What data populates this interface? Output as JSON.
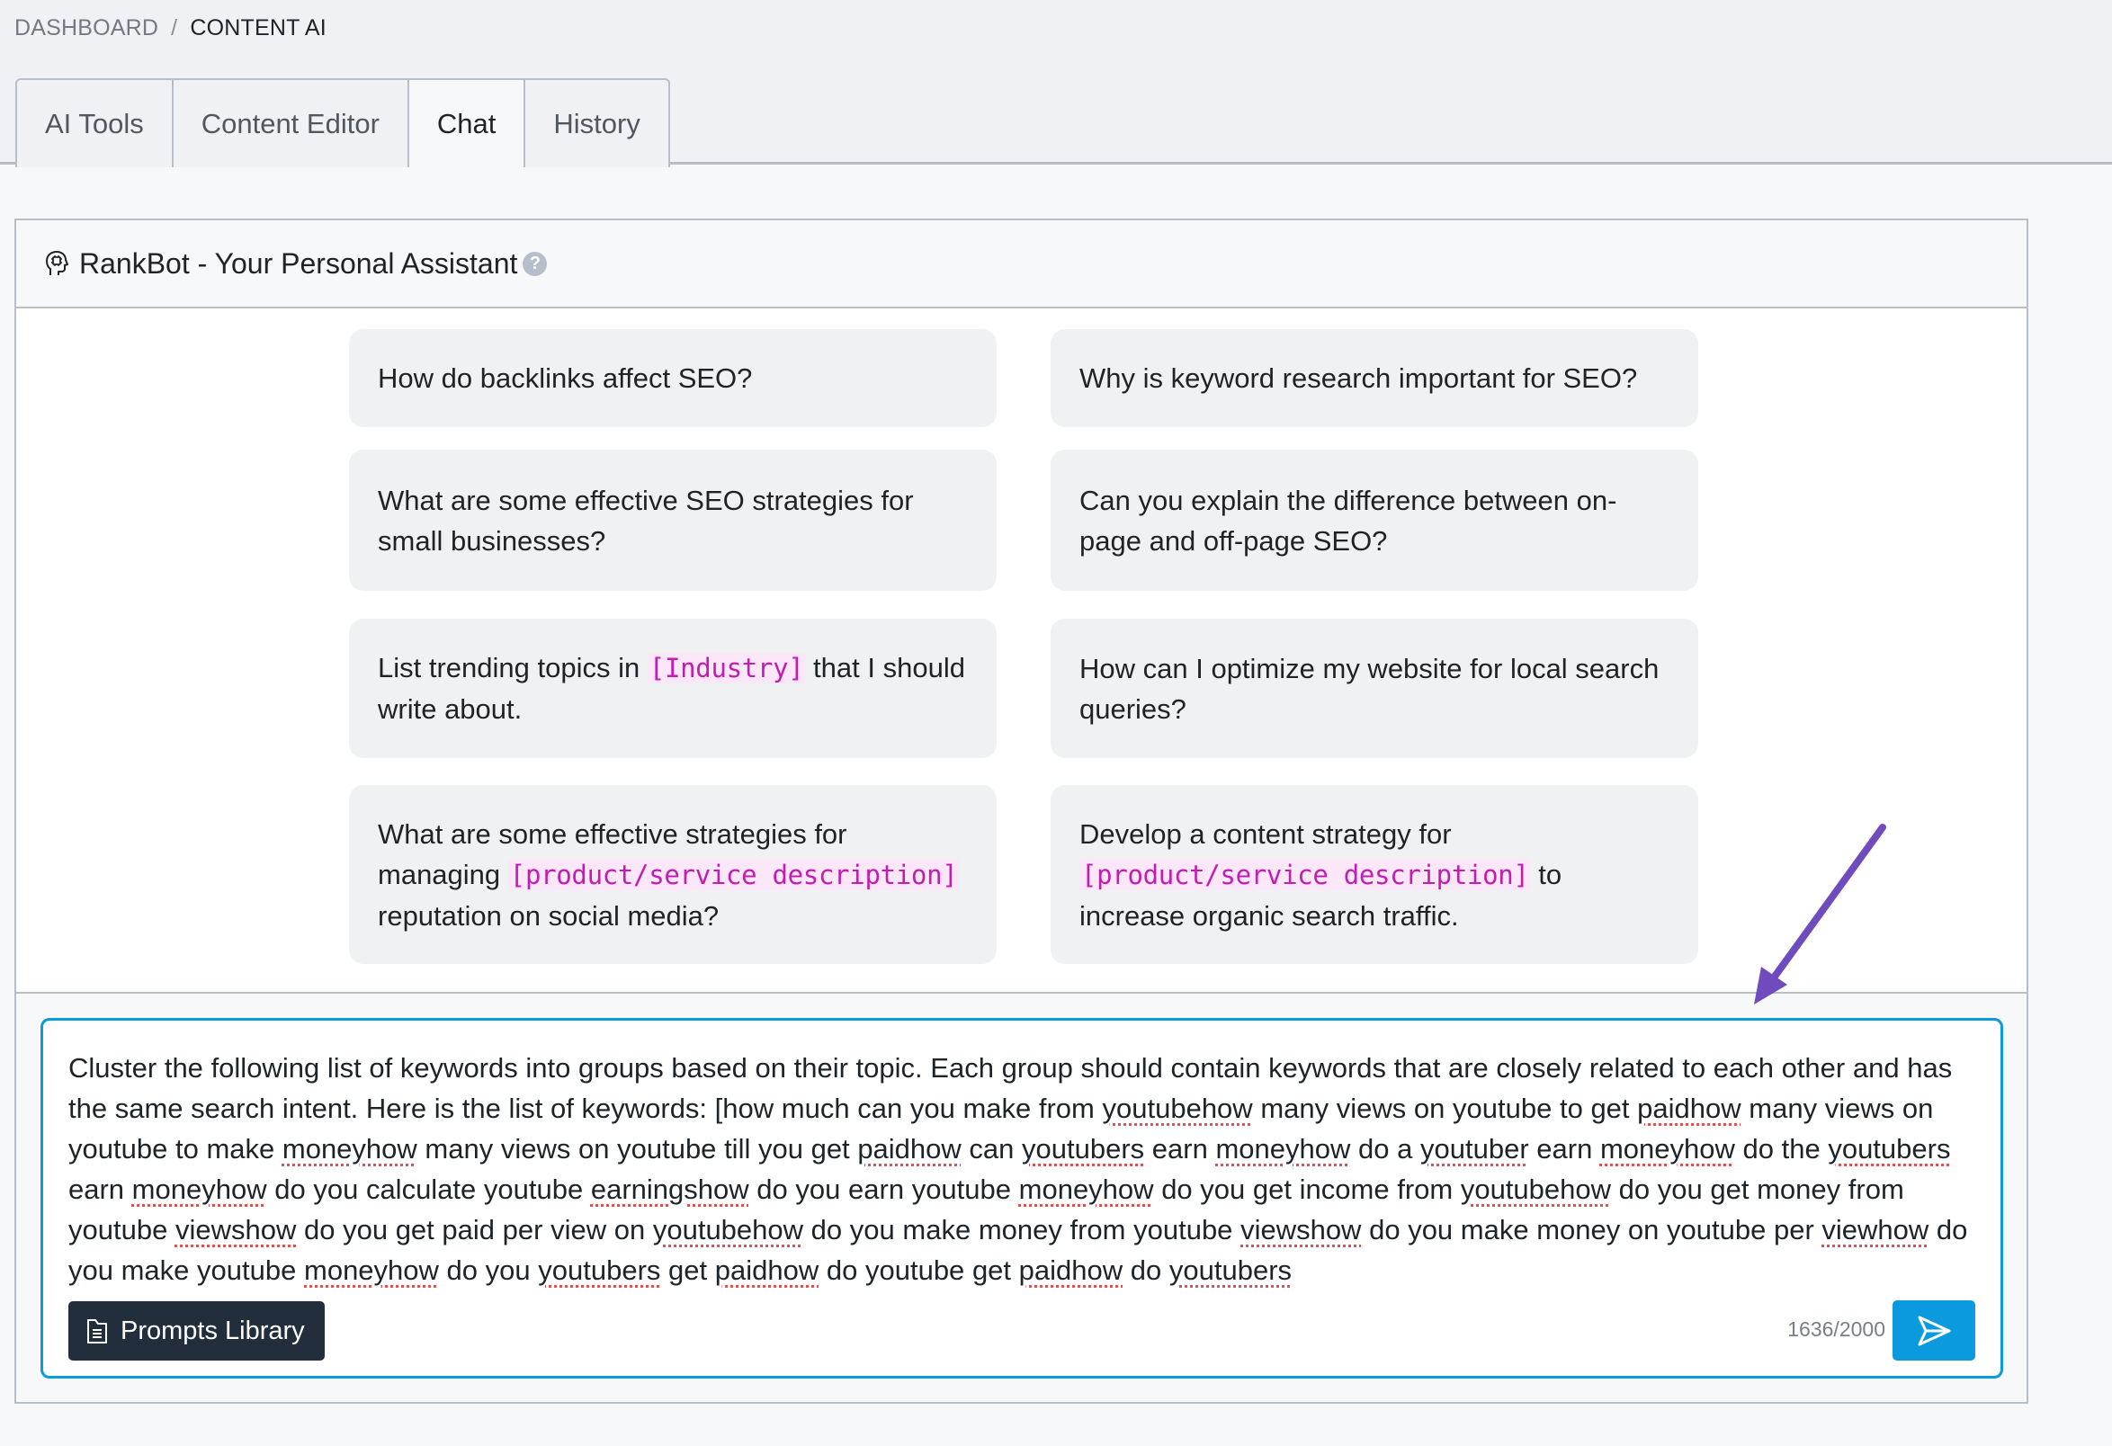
{
  "breadcrumb": {
    "parent": "DASHBOARD",
    "separator": "/",
    "current": "CONTENT AI"
  },
  "tabs": [
    {
      "label": "AI Tools",
      "active": false
    },
    {
      "label": "Content Editor",
      "active": false
    },
    {
      "label": "Chat",
      "active": true
    },
    {
      "label": "History",
      "active": false
    }
  ],
  "panel": {
    "title": "RankBot - Your Personal Assistant",
    "title_icon": "brain-head-icon",
    "help_icon": "help-circle-icon",
    "help_glyph": "?"
  },
  "prompt_cards": [
    {
      "parts": [
        {
          "text": "How do backlinks affect SEO?"
        }
      ]
    },
    {
      "parts": [
        {
          "text": "Why is keyword research important for SEO?"
        }
      ]
    },
    {
      "parts": [
        {
          "text": "What are some effective SEO strategies for small businesses?"
        }
      ]
    },
    {
      "parts": [
        {
          "text": "Can you explain the difference between on-page and off-page SEO?"
        }
      ]
    },
    {
      "parts": [
        {
          "text": "List trending topics in "
        },
        {
          "code": "[Industry]"
        },
        {
          "text": " that I should write about."
        }
      ]
    },
    {
      "parts": [
        {
          "text": "How can I optimize my website for local search queries?"
        }
      ]
    },
    {
      "parts": [
        {
          "text": "What are some effective strategies for managing "
        },
        {
          "code": "[product/service description]"
        },
        {
          "text": " reputation on social media?"
        }
      ]
    },
    {
      "parts": [
        {
          "text": "Develop a content strategy for "
        },
        {
          "code": "[product/service description]"
        },
        {
          "text": " to increase organic search traffic."
        }
      ]
    }
  ],
  "chat_input": {
    "value": "Cluster the following list of keywords into groups based on their topic. Each group should contain keywords that are closely related to each other and has the same search intent. Here is the list of keywords: [how much can you make from youtubehow many views on youtube to get paidhow many views on youtube to make moneyhow many views on youtube till you get paidhow can youtubers earn moneyhow do a youtuber earn moneyhow do the youtubers earn moneyhow do you calculate youtube earningshow do you earn youtube moneyhow do you get income from youtubehow do you get money from youtube viewshow do you get paid per view on youtubehow do you make money from youtube viewshow do you make money on youtube per viewhow do you make youtube moneyhow do you youtubers get paidhow do youtube get paidhow do youtubers",
    "misspelled_words": [
      "youtubehow",
      "paidhow",
      "moneyhow",
      "youtubers",
      "youtuber",
      "earningshow",
      "viewshow",
      "viewhow"
    ],
    "char_count": "1636/2000"
  },
  "buttons": {
    "prompts_library": "Prompts Library",
    "prompts_library_icon": "document-icon",
    "send_icon": "send-icon"
  },
  "annotation": {
    "type": "arrow",
    "color": "#6f4bbd",
    "points_to": "chat-input"
  },
  "colors": {
    "accent": "#0b9ade",
    "dark_button": "#222e3c",
    "placeholder_code": "#c21cb3",
    "code_bg": "#fbe7f8",
    "spellcheck": "#e0524f"
  }
}
